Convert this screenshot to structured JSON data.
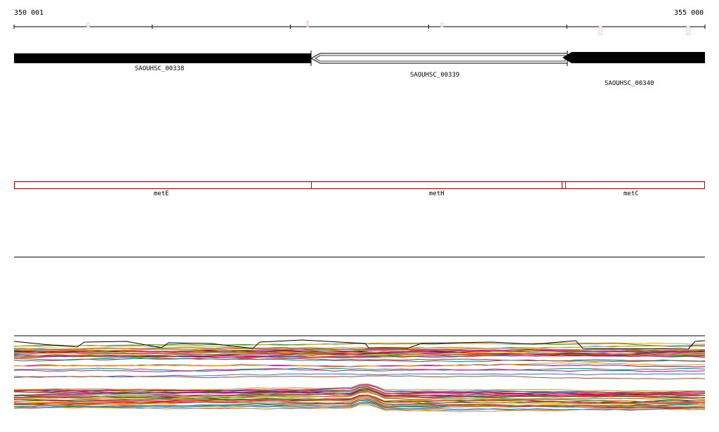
{
  "ruler": {
    "start_label": "350 001",
    "end_label": "355 000",
    "tick_count": 6
  },
  "genes": [
    {
      "id": "SAOUHSC_00338",
      "label": "SAOUHSC_00338",
      "strand": "+",
      "style": "filled"
    },
    {
      "id": "SAOUHSC_00339",
      "label": "SAOUHSC_00339",
      "strand": "-",
      "style": "outline"
    },
    {
      "id": "SAOUHSC_00340",
      "label": "SAOUHSC_00340",
      "strand": "-",
      "style": "filled"
    }
  ],
  "regions": [
    {
      "label": "metE"
    },
    {
      "label": "metH"
    },
    {
      "label": "metC"
    }
  ],
  "colors": {
    "gene_fill": "#000000",
    "region_outline": "#cc0000",
    "axis": "#000000",
    "marker": "#f3c2b8"
  },
  "expression_track": {
    "line_count": 60
  }
}
